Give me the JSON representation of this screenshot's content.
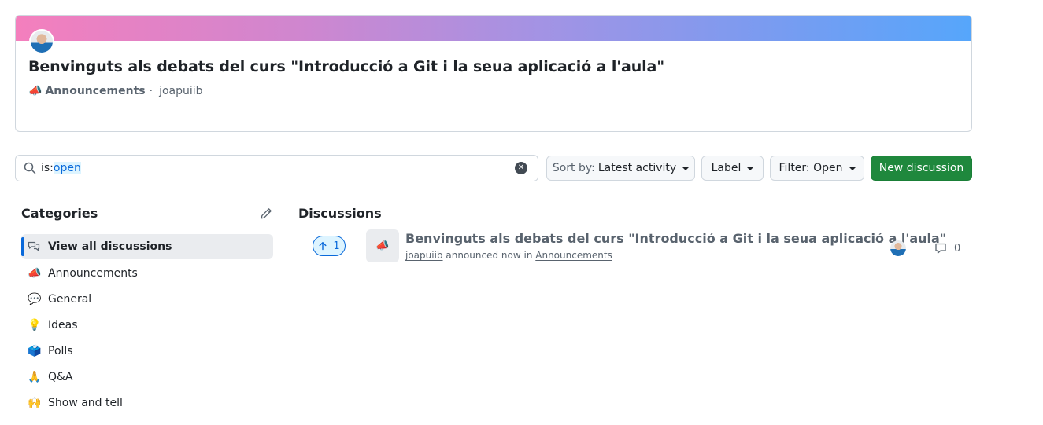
{
  "header": {
    "title": "Benvinguts als debats del curs \"Introducció a Git i la seua aplicació a l'aula\"",
    "category_emoji": "📣",
    "category": "Announcements",
    "separator": "·",
    "author": "joapuiib"
  },
  "search": {
    "prefix": "is:",
    "value": "open",
    "clear_icon": "x-circle-fill-icon"
  },
  "toolbar": {
    "sort_prefix": "Sort by:",
    "sort_value": "Latest activity",
    "label": "Label",
    "filter": "Filter: Open",
    "new_discussion": "New discussion"
  },
  "sidebar": {
    "heading": "Categories",
    "items": [
      {
        "emoji": "",
        "label": "View all discussions",
        "active": true
      },
      {
        "emoji": "📣",
        "label": "Announcements"
      },
      {
        "emoji": "💬",
        "label": "General"
      },
      {
        "emoji": "💡",
        "label": "Ideas"
      },
      {
        "emoji": "🗳️",
        "label": "Polls"
      },
      {
        "emoji": "🙏",
        "label": "Q&A"
      },
      {
        "emoji": "🙌",
        "label": "Show and tell"
      }
    ]
  },
  "discussions": {
    "heading": "Discussions",
    "items": [
      {
        "upvotes": "1",
        "emoji": "📣",
        "title": "Benvinguts als debats del curs \"Introducció a Git i la seua aplicació a l'aula\"",
        "author": "joapuiib",
        "action": "announced now in",
        "category": "Announcements",
        "comments": "0"
      }
    ]
  },
  "colors": {
    "accent": "#0969da",
    "primary_button": "#1f883d",
    "banner_start": "#f47fbd",
    "banner_end": "#56a6fb"
  }
}
